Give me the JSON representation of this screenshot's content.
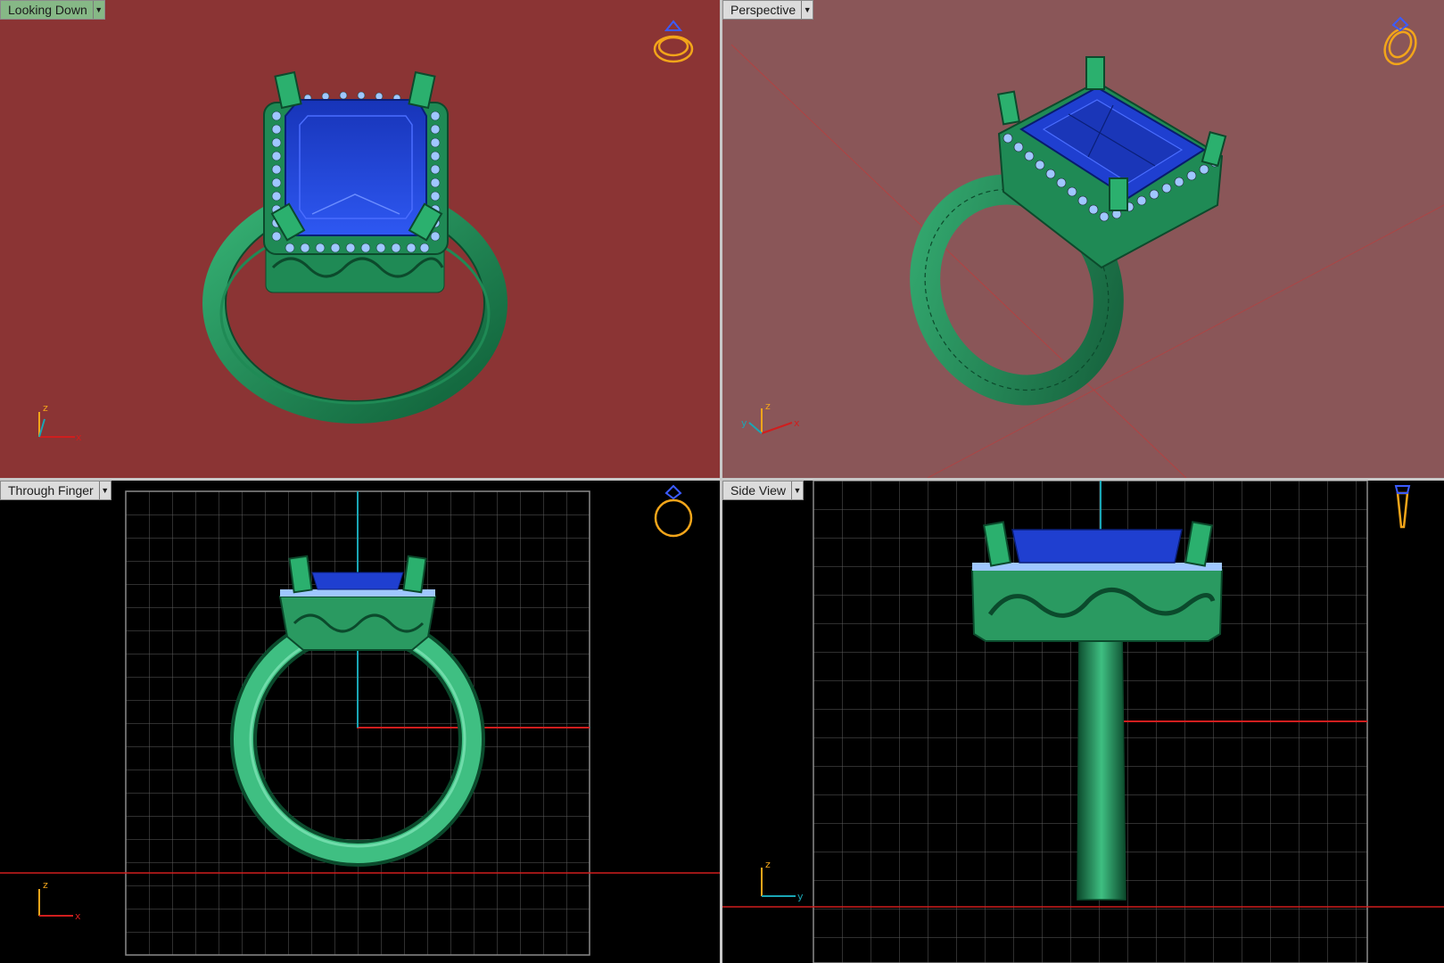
{
  "viewports": [
    {
      "label": "Looking Down",
      "background": "#8b3434",
      "active": true
    },
    {
      "label": "Perspective",
      "background": "#8a5658",
      "active": false
    },
    {
      "label": "Through Finger",
      "background": "#000000",
      "active": false
    },
    {
      "label": "Side View",
      "background": "#000000",
      "active": false
    }
  ],
  "icons": {
    "dropdown": "chevron-down-icon",
    "ring_preview": "ring-preview-icon",
    "axis_gizmo": "axis-triad-icon"
  },
  "axes": {
    "x": "x",
    "y": "y",
    "z": "z"
  },
  "colors": {
    "metal": "#2fa36a",
    "metal_dark": "#0e5a36",
    "stone": "#1f3fd0",
    "stone_light": "#2c55f0",
    "accent_stones": "#9fc7ff",
    "grid": "#6a6a6a",
    "x_axis": "#d01e1e",
    "z_axis": "#1aa6b5",
    "gizmo": "#f2a51a"
  }
}
